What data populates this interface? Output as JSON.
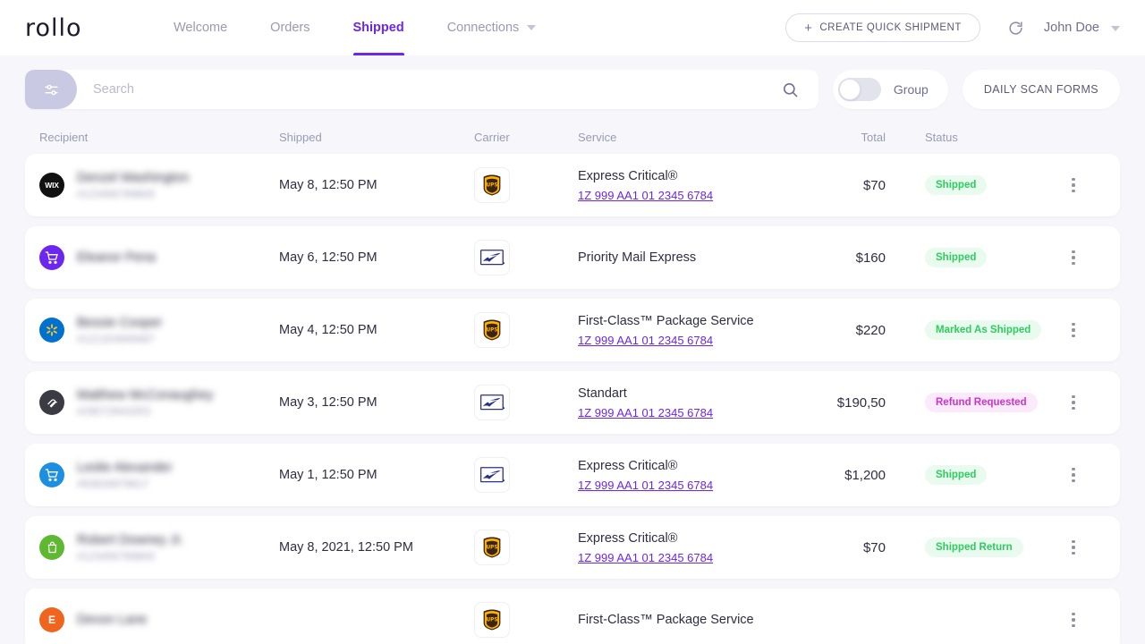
{
  "header": {
    "logo": "rollo",
    "nav": [
      {
        "label": "Welcome",
        "active": false,
        "has_caret": false
      },
      {
        "label": "Orders",
        "active": false,
        "has_caret": false
      },
      {
        "label": "Shipped",
        "active": true,
        "has_caret": false
      },
      {
        "label": "Connections",
        "active": false,
        "has_caret": true
      }
    ],
    "create_button": "CREATE QUICK SHIPMENT",
    "plus_icon": "plus-icon",
    "refresh_icon": "refresh-icon",
    "user_name": "John Doe",
    "user_caret_icon": "chevron-down-icon"
  },
  "toolbar": {
    "filter_icon": "sliders-icon",
    "search_placeholder": "Search",
    "search_value": "",
    "search_icon": "search-icon",
    "group_label": "Group",
    "group_enabled": false,
    "daily_scan_forms": "DAILY SCAN FORMS"
  },
  "table": {
    "columns": [
      "Recipient",
      "Shipped",
      "Carrier",
      "Service",
      "Total",
      "Status"
    ],
    "rows": [
      {
        "avatar": "wix-icon",
        "recipient_name": "Denzel Washington",
        "recipient_id": "#123456789800",
        "shipped": "May 8, 12:50 PM",
        "carrier": "ups-logo",
        "service": "Express Critical®",
        "tracking": "1Z 999 AA1 01 2345 6784",
        "total": "$70",
        "status": "Shipped",
        "status_color": "green",
        "menu_icon": "more-vertical-icon"
      },
      {
        "avatar": "woocommerce-cart-icon",
        "recipient_name": "Eleanor Pena",
        "recipient_id": "",
        "shipped": "May 6, 12:50 PM",
        "carrier": "usps-logo",
        "service": "Priority Mail Express",
        "tracking": "",
        "total": "$160",
        "status": "Shipped",
        "status_color": "green",
        "menu_icon": "more-vertical-icon"
      },
      {
        "avatar": "walmart-icon",
        "recipient_name": "Bessie Cooper",
        "recipient_id": "#121324949487",
        "shipped": "May 4, 12:50 PM",
        "carrier": "ups-logo",
        "service": "First-Class™ Package Service",
        "tracking": "1Z 999 AA1 01 2345 6784",
        "total": "$220",
        "status": "Marked As Shipped",
        "status_color": "green",
        "menu_icon": "more-vertical-icon"
      },
      {
        "avatar": "squarespace-icon",
        "recipient_name": "Matthew McConaughey",
        "recipient_id": "#295729432R3",
        "shipped": "May 3, 12:50 PM",
        "carrier": "usps-logo",
        "service": "Standart",
        "tracking": "1Z 999 AA1 01 2345 6784",
        "total": "$190,50",
        "status": "Refund Requested",
        "status_color": "magenta",
        "menu_icon": "more-vertical-icon"
      },
      {
        "avatar": "bigcommerce-cart-icon",
        "recipient_name": "Leslie Alexander",
        "recipient_id": "#93834979817",
        "shipped": "May 1, 12:50 PM",
        "carrier": "usps-logo",
        "service": "Express Critical®",
        "tracking": "1Z 999 AA1 01 2345 6784",
        "total": "$1,200",
        "status": "Shipped",
        "status_color": "green",
        "menu_icon": "more-vertical-icon"
      },
      {
        "avatar": "shopify-icon",
        "recipient_name": "Robert Downey Jr.",
        "recipient_id": "#123456789800",
        "shipped": "May 8, 2021, 12:50 PM",
        "carrier": "ups-logo",
        "service": "Express Critical®",
        "tracking": "1Z 999 AA1 01 2345 6784",
        "total": "$70",
        "status": "Shipped Return",
        "status_color": "green",
        "menu_icon": "more-vertical-icon"
      },
      {
        "avatar": "etsy-icon",
        "recipient_name": "Devon Lane",
        "recipient_id": "",
        "shipped": "",
        "carrier": "ups-logo",
        "service": "First-Class™ Package Service",
        "tracking": "",
        "total": "",
        "status": "",
        "status_color": "green",
        "menu_icon": "more-vertical-icon"
      }
    ]
  },
  "colors": {
    "accent": "#6b26f0",
    "page_bg": "#f7f7fb",
    "status_green": "#2ecc5f",
    "status_magenta": "#cc33cc",
    "muted_text": "#9a9ab5"
  }
}
